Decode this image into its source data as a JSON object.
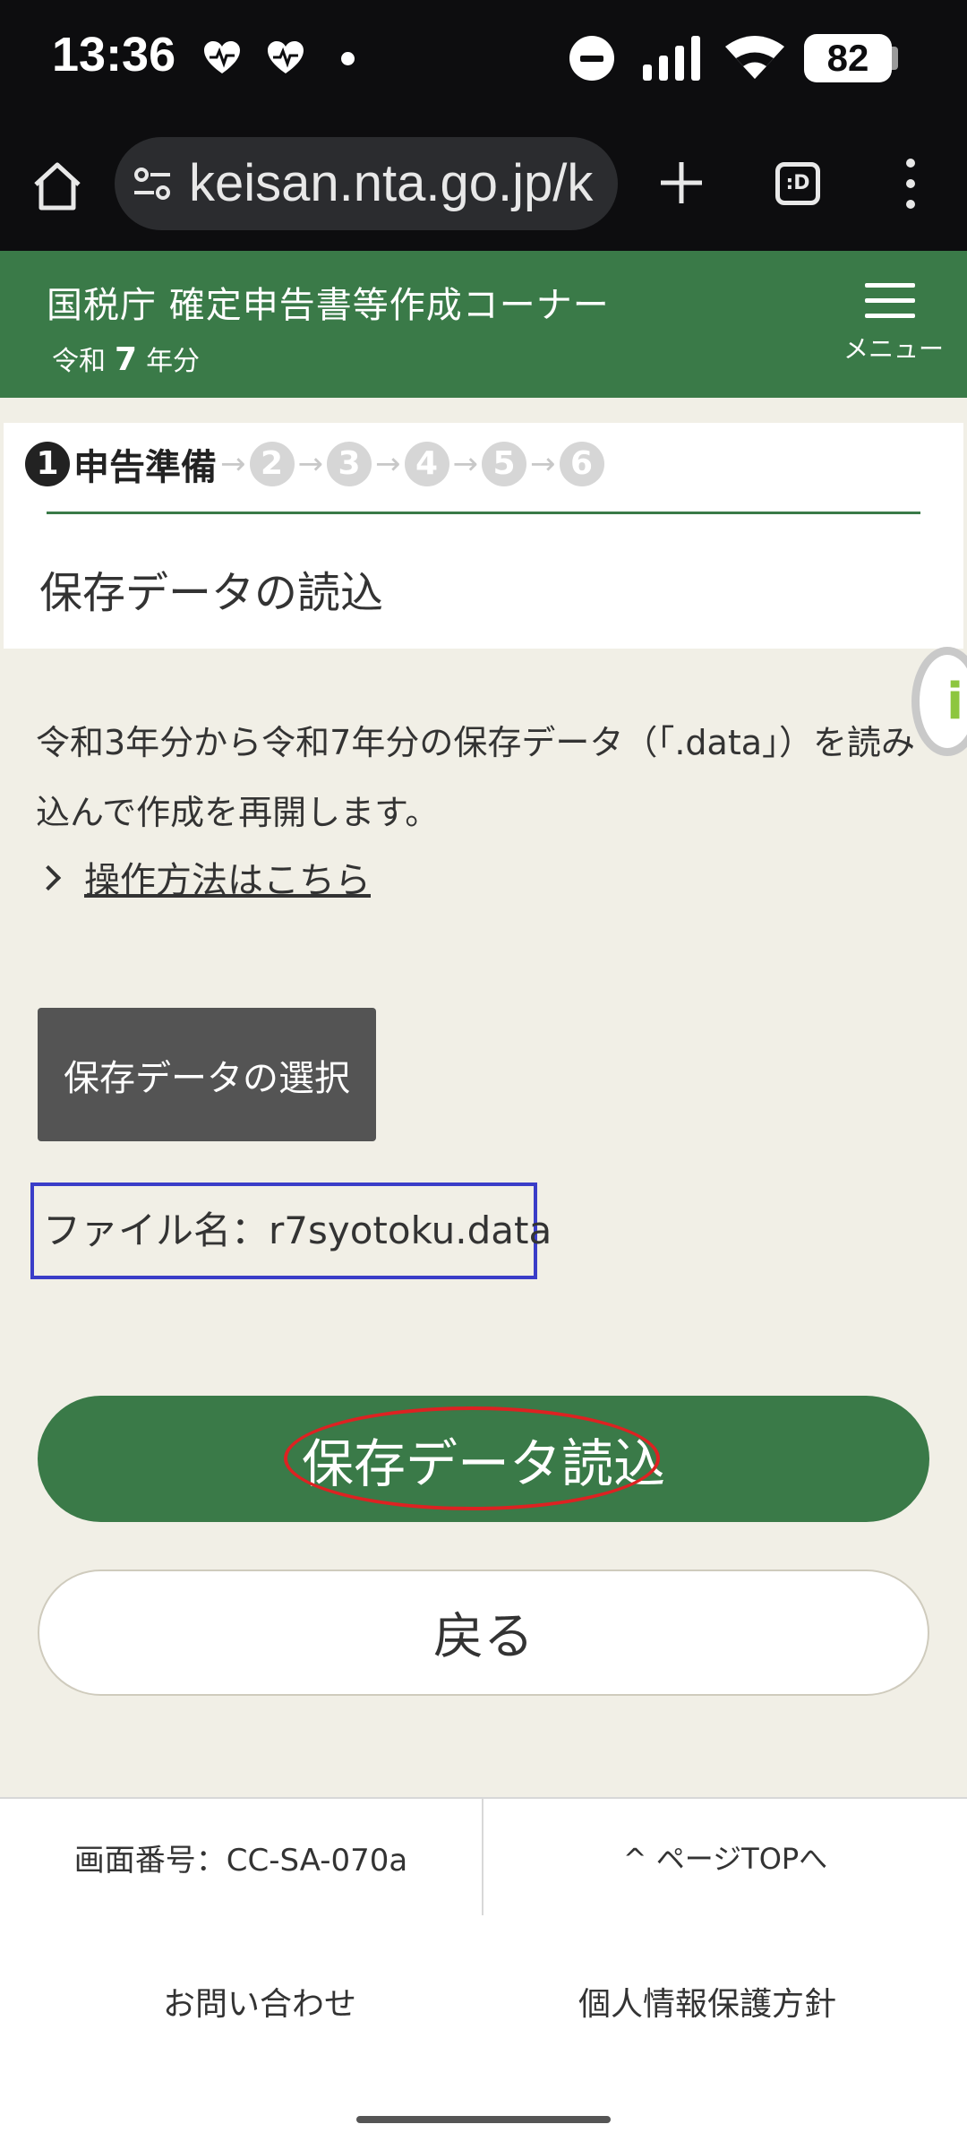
{
  "status_bar": {
    "time": "13:36",
    "battery": "82",
    "icons": [
      "heart-pulse-icon",
      "heart-pulse-icon",
      "dot-icon",
      "do-not-disturb-icon",
      "signal-icon",
      "wifi-icon",
      "battery-icon"
    ]
  },
  "browser": {
    "url": "keisan.nta.go.jp/k",
    "tabs_label": ":D"
  },
  "header": {
    "title": "国税庁 確定申告書等作成コーナー",
    "year_prefix": "令和",
    "year_number": "7",
    "year_suffix": "年分",
    "menu_label": "メニュー"
  },
  "steps": {
    "current_number": "1",
    "current_label": "申告準備",
    "others": [
      "2",
      "3",
      "4",
      "5",
      "6"
    ]
  },
  "page": {
    "title": "保存データの読込",
    "description": "令和3年分から令和7年分の保存データ（「.data」）を読み込んで作成を再開します。",
    "howto_link": "操作方法はこちら",
    "select_button": "保存データの選択",
    "filename": "ファイル名：r7syotoku.data",
    "load_button": "保存データ読込",
    "back_button": "戻る"
  },
  "footer": {
    "screen_number": "画面番号：CC-SA-070a",
    "page_top": "^ ページTOPへ",
    "contact": "お問い合わせ",
    "privacy": "個人情報保護方針"
  },
  "colors": {
    "brand_green": "#3a7a48",
    "background": "#f1efe6",
    "select_button": "#545454",
    "filename_border": "#3a3dc8",
    "annotation_ellipse": "#dd2222"
  }
}
